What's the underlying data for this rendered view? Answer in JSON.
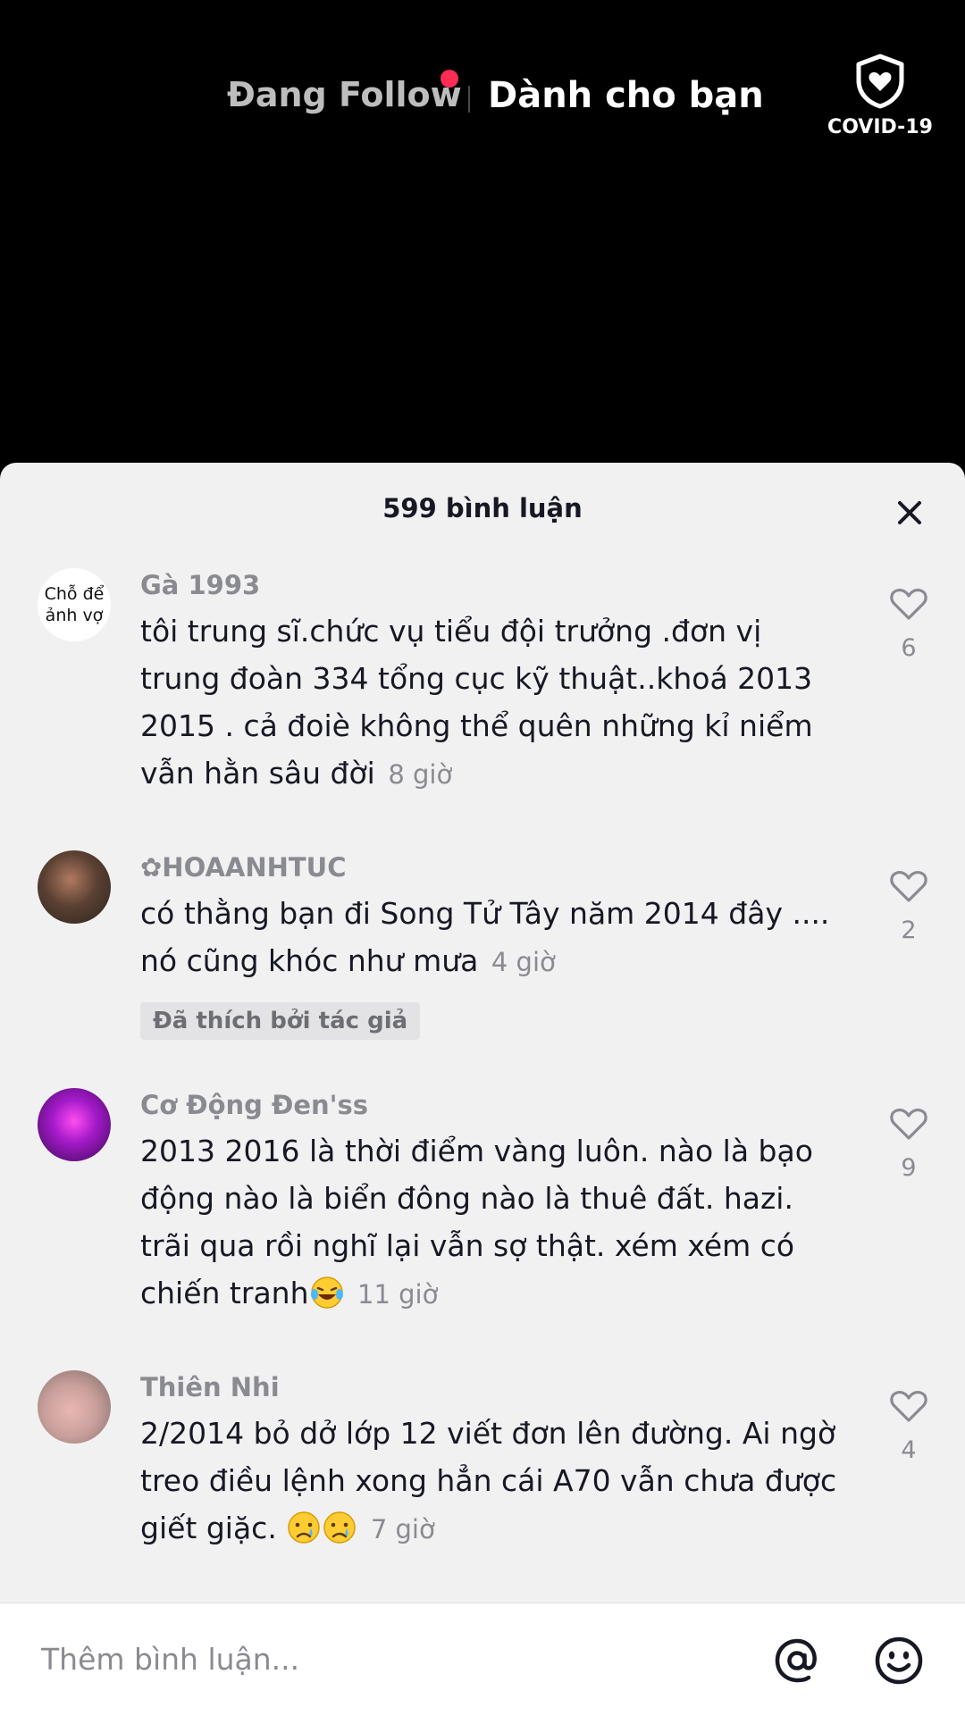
{
  "nav": {
    "following_tab": "Đang Follow",
    "for_you_tab": "Dành cho bạn",
    "covid_label": "COVID-19"
  },
  "colors": {
    "notification_dot": "#fe2c55",
    "sheet_background": "#f1f1f2",
    "muted_text": "#8a8b91"
  },
  "comments_sheet": {
    "title": "599 bình luận",
    "comments": [
      {
        "avatar_text": "Chỗ để ảnh vợ",
        "username": "Gà 1993",
        "text": "tôi trung sĩ.chức vụ tiểu đội trưởng .đơn vị trung đoàn 334 tổng cục kỹ thuật..khoá 2013 2015 . cả đoiè không thể quên những kỉ niểm vẫn hằn sâu đời",
        "time": "8 giờ",
        "likes": "6"
      },
      {
        "username": "✿HOAANHTUC",
        "text": "có thằng bạn đi Song Tử Tây năm 2014 đây .... nó cũng khóc như mưa",
        "time": "4 giờ",
        "badge": "Đã thích bởi tác giả",
        "likes": "2"
      },
      {
        "username": "Cơ Động Đen'ss",
        "text": "2013 2016 là thời điểm vàng luôn. nào là bạo động nào là biển đông nào là thuê đất. hazi. trãi qua rồi nghĩ lại vẫn sợ thật. xém xém có chiến tranh",
        "time": "11 giờ",
        "likes": "9"
      },
      {
        "username": "Thiên Nhi",
        "text": "2/2014 bỏ dở lớp 12 viết đơn lên đường. Ai ngờ treo điều lệnh xong hẳn cái A70 vẫn chưa được giết giặc.",
        "time": "7 giờ",
        "likes": "4"
      }
    ]
  },
  "input": {
    "placeholder": "Thêm bình luận..."
  }
}
